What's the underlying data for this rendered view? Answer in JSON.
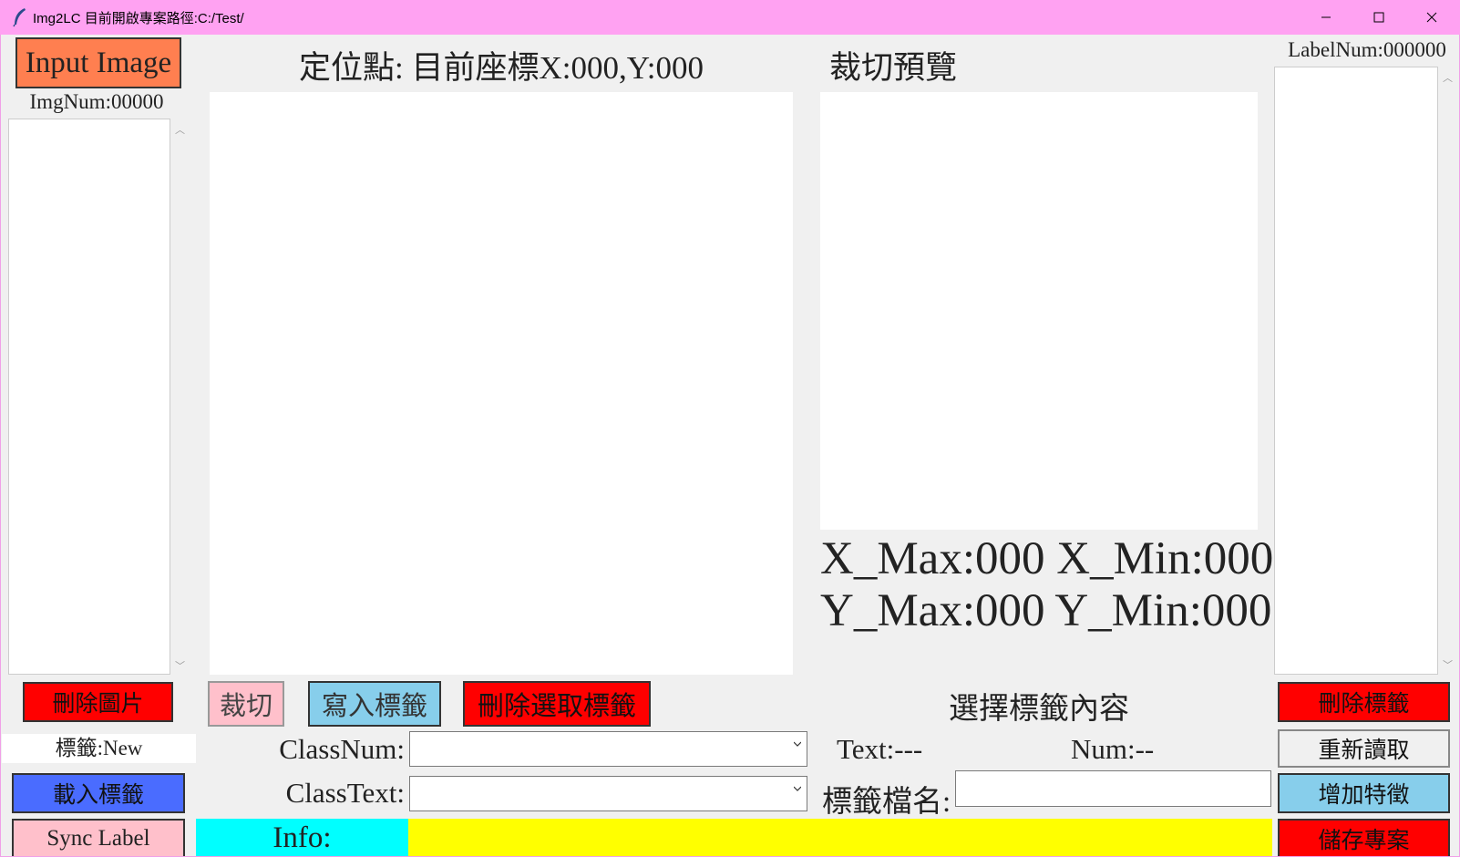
{
  "window": {
    "title": "Img2LC 目前開啟專案路徑:C:/Test/",
    "controls": {
      "minimize": "minimize-icon",
      "maximize": "maximize-icon",
      "close": "close-icon"
    }
  },
  "left": {
    "input_image_label": "Input Image",
    "img_num": "ImgNum:00000",
    "delete_image_label": "刪除圖片",
    "label_status": "標籤:New",
    "load_label_label": "載入標籤",
    "sync_label_label": "Sync Label"
  },
  "center": {
    "position_text": "定位點: 目前座標X:000,Y:000",
    "crop_label": "裁切",
    "write_label_label": "寫入標籤",
    "delete_selected_label": "刪除選取標籤",
    "class_num_label": "ClassNum:",
    "class_num_value": "",
    "class_text_label": "ClassText:",
    "class_text_value": ""
  },
  "preview": {
    "title": "裁切預覽",
    "x_line": "X_Max:000 X_Min:000",
    "y_line": "Y_Max:000 Y_Min:000",
    "select_content_title": "選擇標籤內容",
    "text_value": "Text:---",
    "num_value": "Num:--",
    "filename_label": "標籤檔名:",
    "filename_value": ""
  },
  "right": {
    "label_num": "LabelNum:000000",
    "delete_label_label": "刪除標籤",
    "reload_label": "重新讀取",
    "add_feature_label": "增加特徵",
    "save_project_label": "儲存專案"
  },
  "info": {
    "label": "Info:",
    "value": ""
  },
  "colors": {
    "titlebar": "#ffa2f2",
    "input_image_button": "#ff7f50",
    "red_button": "#ff0000",
    "pink_button": "#ffc0cb",
    "sky_button": "#87ceeb",
    "blue_button": "#4a6cff",
    "info_label_bg": "#00ffff",
    "info_value_bg": "#ffff00"
  }
}
